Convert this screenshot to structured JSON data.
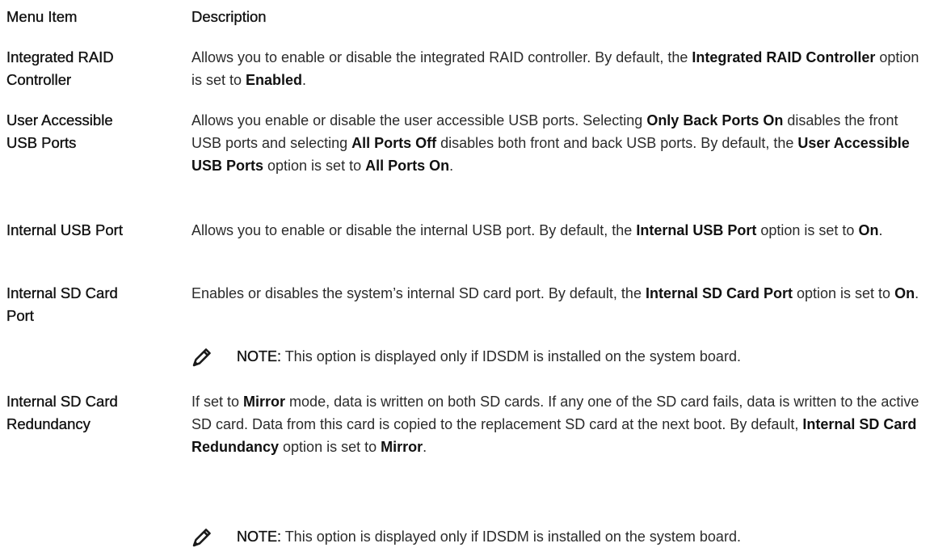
{
  "header": {
    "menu_item": "Menu Item",
    "description": "Description"
  },
  "rows": [
    {
      "term_lines": [
        "Integrated RAID",
        "Controller"
      ],
      "desc": [
        {
          "t": "Allows you to enable or disable the integrated RAID controller. By default, the "
        },
        {
          "t": "Integrated RAID Controller",
          "b": true
        },
        {
          "t": " option is set to "
        },
        {
          "t": "Enabled",
          "b": true
        },
        {
          "t": "."
        }
      ]
    },
    {
      "term_lines": [
        "User Accessible",
        "USB Ports"
      ],
      "desc": [
        {
          "t": "Allows you enable or disable the user accessible USB ports. Selecting "
        },
        {
          "t": "Only Back Ports On",
          "b": true
        },
        {
          "t": " disables the front USB ports and selecting "
        },
        {
          "t": "All Ports Off",
          "b": true
        },
        {
          "t": " disables both front and back USB ports. By default, the "
        },
        {
          "t": "User Accessible USB Ports",
          "b": true
        },
        {
          "t": " option is set to "
        },
        {
          "t": "All Ports On",
          "b": true
        },
        {
          "t": "."
        }
      ]
    },
    {
      "term_lines": [
        "Internal USB Port"
      ],
      "desc": [
        {
          "t": "Allows you to enable or disable the internal USB port. By default, the "
        },
        {
          "t": "Internal USB Port",
          "b": true
        },
        {
          "t": " option is set to "
        },
        {
          "t": "On",
          "b": true
        },
        {
          "t": "."
        }
      ]
    },
    {
      "term_lines": [
        "Internal SD Card",
        "Port"
      ],
      "desc": [
        {
          "t": "Enables or disables the system’s internal SD card port. By default, the "
        },
        {
          "t": "Internal SD Card Port",
          "b": true
        },
        {
          "t": " option is set to "
        },
        {
          "t": "On",
          "b": true
        },
        {
          "t": "."
        }
      ],
      "note": {
        "label": "NOTE:",
        "text": " This option is displayed only if IDSDM is installed on the system board."
      }
    },
    {
      "term_lines": [
        "Internal SD Card",
        "Redundancy"
      ],
      "desc": [
        {
          "t": "If set to "
        },
        {
          "t": "Mirror",
          "b": true
        },
        {
          "t": " mode, data is written on both SD cards. If any one of the SD card fails, data is written to the active SD card. Data from this card is copied to the replacement SD card at the next boot. By default, "
        },
        {
          "t": "Internal SD Card Redundancy",
          "b": true
        },
        {
          "t": " option is set to "
        },
        {
          "t": "Mirror",
          "b": true
        },
        {
          "t": "."
        }
      ],
      "note": {
        "label": "NOTE:",
        "text": " This option is displayed only if IDSDM is installed on the system board."
      }
    }
  ],
  "icons": {
    "note_icon": "pencil-note-icon"
  }
}
